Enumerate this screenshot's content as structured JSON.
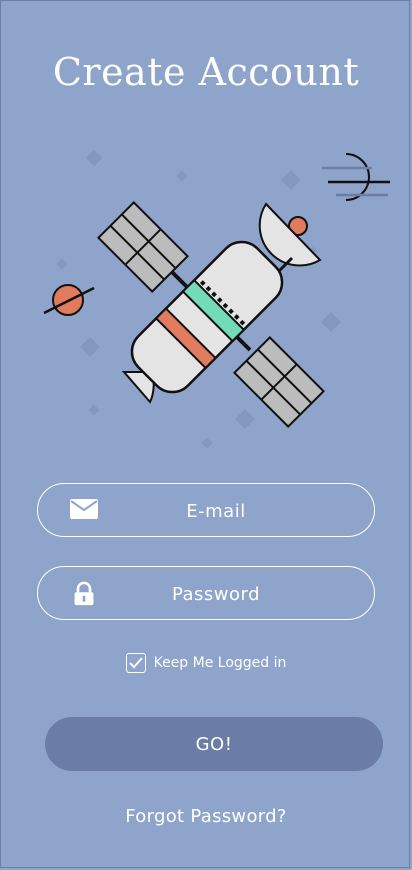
{
  "header": {
    "title": "Create Account"
  },
  "illustration": {
    "name": "satellite-illustration",
    "accent": "#74dbb8",
    "orange": "#e07b5e",
    "body": "#e4e4e4"
  },
  "form": {
    "email_placeholder": "E-mail",
    "password_placeholder": "Password",
    "remember_label": "Keep Me Logged in",
    "remember_checked": true,
    "submit_label": "GO!",
    "forgot_label": "Forgot Password?"
  },
  "icons": {
    "email": "envelope-icon",
    "password": "lock-icon",
    "check": "check-icon"
  },
  "colors": {
    "background": "#8fa4cb",
    "button": "#6b7da6",
    "text": "#ffffff"
  }
}
